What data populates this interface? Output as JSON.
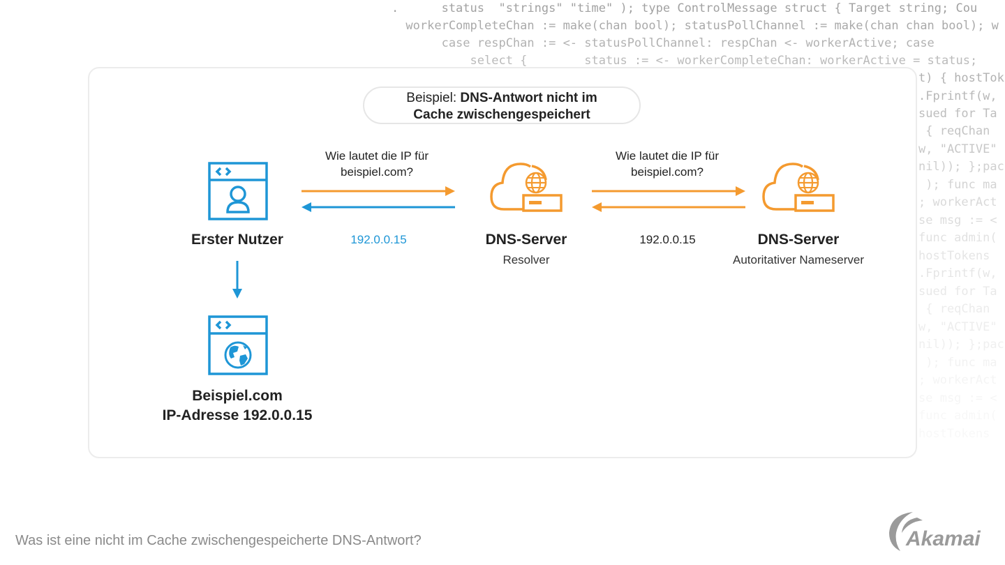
{
  "background_code": [
    "    .      status  \"strings\" \"time\" ); type ControlMessage struct { Target string; Cou",
    "      workerCompleteChan := make(chan bool); statusPollChannel := make(chan chan bool); w",
    "           case respChan := <- statusPollChannel: respChan <- workerActive; case",
    "               select {        status := <- workerCompleteChan: workerActive = status;",
    "t) { hostTok",
    ".Fprintf(w,",
    "sued for Ta",
    " { reqChan",
    "w, \"ACTIVE\"",
    "nil)); };pac",
    " ); func ma",
    "; workerAct",
    "se msg := <",
    "func admin(",
    "hostTokens",
    ".Fprintf(w,",
    "sued for Ta",
    " { reqChan",
    "w, \"ACTIVE\"",
    "nil)); };pac",
    " ); func ma",
    "; workerAct",
    "se msg := <",
    "func admin(",
    "hostTokens"
  ],
  "title": {
    "lead": "Beispiel: ",
    "bold_line1": "DNS-Antwort nicht im",
    "bold_line2": "Cache zwischengespeichert"
  },
  "nodes": {
    "user": {
      "label": "Erster Nutzer",
      "icon": "browser-user-icon"
    },
    "resolver": {
      "label": "DNS-Server",
      "sublabel": "Resolver",
      "icon": "cloud-server-globe-icon"
    },
    "authoritative": {
      "label": "DNS-Server",
      "sublabel": "Autoritativer Nameserver",
      "icon": "cloud-server-globe-icon"
    },
    "website": {
      "label_line1": "Beispiel.com",
      "label_line2": "IP-Adresse 192.0.0.15",
      "icon": "browser-globe-icon"
    }
  },
  "edges": {
    "user_to_resolver": {
      "question_line1": "Wie lautet die IP für",
      "question_line2": "beispiel.com?",
      "answer": "192.0.0.15"
    },
    "resolver_to_authoritative": {
      "question_line1": "Wie lautet die IP für",
      "question_line2": "beispiel.com?",
      "answer": "192.0.0.15"
    }
  },
  "footer": {
    "caption": "Was ist eine nicht im Cache zwischengespeicherte DNS-Antwort?",
    "logo_text": "Akamai"
  },
  "colors": {
    "blue": "#1e96d6",
    "orange": "#f49a2f",
    "text_dark": "#222222",
    "caption_gray": "#8a8a8a",
    "logo_gray": "#9a9a9a"
  }
}
